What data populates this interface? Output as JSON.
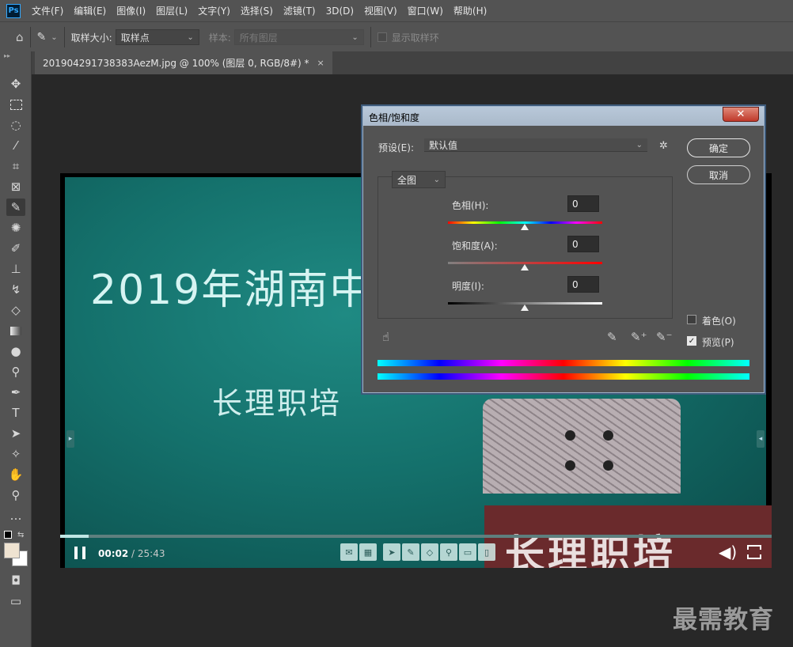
{
  "app": {
    "logo": "Ps",
    "menu": [
      "文件(F)",
      "编辑(E)",
      "图像(I)",
      "图层(L)",
      "文字(Y)",
      "选择(S)",
      "滤镜(T)",
      "3D(D)",
      "视图(V)",
      "窗口(W)",
      "帮助(H)"
    ]
  },
  "options": {
    "sample_size_label": "取样大小:",
    "sample_size_value": "取样点",
    "sample_label": "样本:",
    "sample_value": "所有图层",
    "show_ring_label": "显示取样环"
  },
  "document": {
    "tab_title": "201904291738383AezM.jpg @ 100% (图层 0, RGB/8#) *",
    "close": "×"
  },
  "tools": [
    "move-icon",
    "marquee-icon",
    "lasso-icon",
    "magic-wand-icon",
    "crop-icon",
    "frame-icon",
    "eyedropper-icon",
    "healing-icon",
    "brush-icon",
    "stamp-icon",
    "history-brush-icon",
    "eraser-icon",
    "gradient-icon",
    "blur-icon",
    "dodge-icon",
    "pen-icon",
    "type-icon",
    "path-select-icon",
    "shape-icon",
    "hand-icon",
    "zoom-icon",
    "more-icon"
  ],
  "image": {
    "title_text": "2019年湖南中",
    "subtitle_text": "长理职培",
    "podium_text": "长理职培",
    "time_current": "00:02",
    "time_total": "/ 25:43",
    "progress": 0.04
  },
  "watermark": "最需教育",
  "dialog": {
    "title": "色相/饱和度",
    "close": "✕",
    "preset_label": "预设(E):",
    "preset_value": "默认值",
    "ok": "确定",
    "cancel": "取消",
    "scope": "全图",
    "hue_label": "色相(H):",
    "hue_value": "0",
    "saturation_label": "饱和度(A):",
    "saturation_value": "0",
    "lightness_label": "明度(I):",
    "lightness_value": "0",
    "colorize_label": "着色(O)",
    "colorize_checked": false,
    "preview_label": "预览(P)",
    "preview_checked": true
  }
}
